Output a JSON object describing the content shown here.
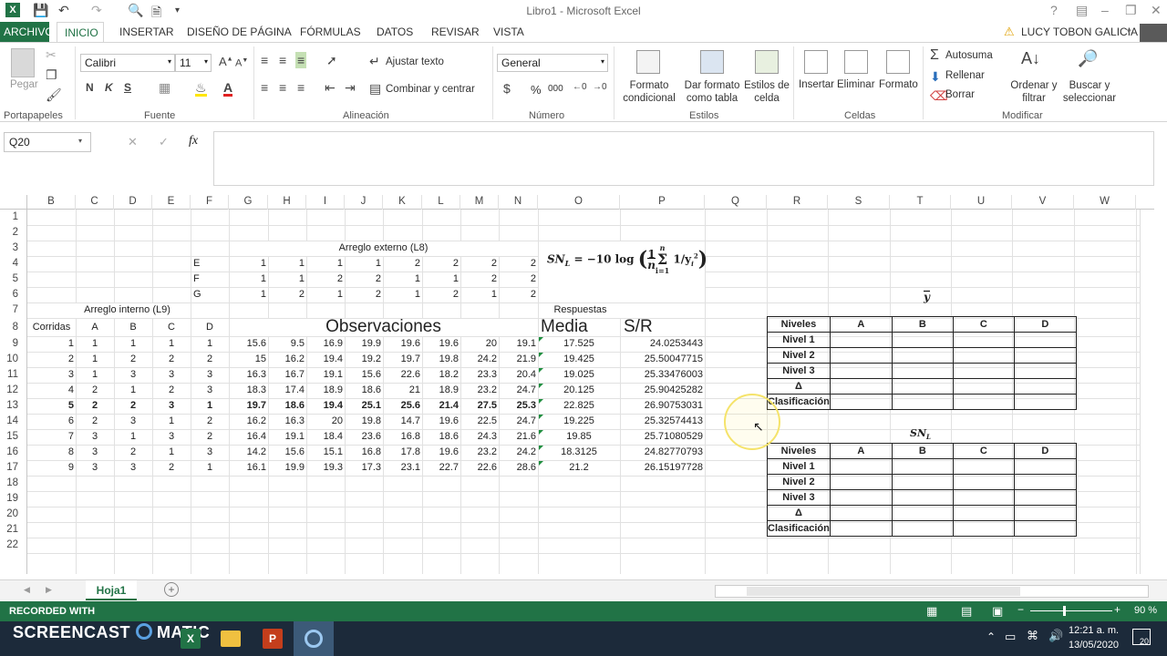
{
  "window": {
    "title": "Libro1 - Microsoft Excel",
    "user": "LUCY TOBON GALICIA"
  },
  "tabs": [
    "ARCHIVO",
    "INICIO",
    "INSERTAR",
    "DISEÑO DE PÁGINA",
    "FÓRMULAS",
    "DATOS",
    "REVISAR",
    "VISTA"
  ],
  "ribbon": {
    "clipboard": {
      "paste": "Pegar",
      "label": "Portapapeles"
    },
    "font": {
      "name": "Calibri",
      "size": "11",
      "bold": "N",
      "italic": "K",
      "underline": "S",
      "label": "Fuente"
    },
    "alignment": {
      "wrap": "Ajustar texto",
      "merge": "Combinar y centrar",
      "label": "Alineación"
    },
    "number": {
      "format": "General",
      "percent": "%",
      "thousands": "000",
      "label": "Número"
    },
    "styles": {
      "conditional": "Formato condicional",
      "as_table": "Dar formato como tabla",
      "cell_styles": "Estilos de celda",
      "label": "Estilos"
    },
    "cells": {
      "insert": "Insertar",
      "delete": "Eliminar",
      "format": "Formato",
      "label": "Celdas"
    },
    "editing": {
      "autosum": "Autosuma",
      "fill": "Rellenar",
      "clear": "Borrar",
      "sort": "Ordenar y filtrar",
      "find": "Buscar y seleccionar",
      "label": "Modificar"
    }
  },
  "formula_bar": {
    "namebox": "Q20",
    "fx": "fx",
    "value": ""
  },
  "columns": [
    "B",
    "C",
    "D",
    "E",
    "F",
    "G",
    "H",
    "I",
    "J",
    "K",
    "L",
    "M",
    "N",
    "O",
    "P",
    "Q",
    "R",
    "S",
    "T",
    "U",
    "V",
    "W"
  ],
  "rows": [
    "1",
    "2",
    "3",
    "4",
    "5",
    "6",
    "7",
    "8",
    "9",
    "10",
    "11",
    "12",
    "13",
    "14",
    "15",
    "16",
    "17",
    "18",
    "19",
    "20",
    "21",
    "22"
  ],
  "sheet": {
    "outer_array_title": "Arreglo externo (L8)",
    "outer_array": [
      {
        "factor": "E",
        "values": [
          "1",
          "1",
          "1",
          "1",
          "2",
          "2",
          "2",
          "2"
        ]
      },
      {
        "factor": "F",
        "values": [
          "1",
          "1",
          "2",
          "2",
          "1",
          "1",
          "2",
          "2"
        ]
      },
      {
        "factor": "G",
        "values": [
          "1",
          "2",
          "1",
          "2",
          "1",
          "2",
          "1",
          "2"
        ]
      }
    ],
    "formula": {
      "lhs": "SN",
      "sub": "L",
      "eq": "= −10 log",
      "frac_top": "1",
      "frac_bot": "n",
      "sum_top": "n",
      "sum_bot": "i=1",
      "term": "1/y",
      "term_sub": "i",
      "term_sup": "2"
    },
    "inner_array_title": "Arreglo interno (L9)",
    "responses_title": "Respuestas",
    "headers": {
      "runs": "Corridas",
      "A": "A",
      "B": "B",
      "C": "C",
      "D": "D",
      "observations": "Observaciones",
      "mean": "Media",
      "sr": "S/R"
    },
    "runs": [
      {
        "n": "1",
        "f": [
          "1",
          "1",
          "1",
          "1"
        ],
        "obs": [
          "15.6",
          "9.5",
          "16.9",
          "19.9",
          "19.6",
          "19.6",
          "20",
          "19.1"
        ],
        "mean": "17.525",
        "sr": "24.0253443",
        "bold": false
      },
      {
        "n": "2",
        "f": [
          "1",
          "2",
          "2",
          "2"
        ],
        "obs": [
          "15",
          "16.2",
          "19.4",
          "19.2",
          "19.7",
          "19.8",
          "24.2",
          "21.9"
        ],
        "mean": "19.425",
        "sr": "25.50047715",
        "bold": false
      },
      {
        "n": "3",
        "f": [
          "1",
          "3",
          "3",
          "3"
        ],
        "obs": [
          "16.3",
          "16.7",
          "19.1",
          "15.6",
          "22.6",
          "18.2",
          "23.3",
          "20.4"
        ],
        "mean": "19.025",
        "sr": "25.33476003",
        "bold": false
      },
      {
        "n": "4",
        "f": [
          "2",
          "1",
          "2",
          "3"
        ],
        "obs": [
          "18.3",
          "17.4",
          "18.9",
          "18.6",
          "21",
          "18.9",
          "23.2",
          "24.7"
        ],
        "mean": "20.125",
        "sr": "25.90425282",
        "bold": false
      },
      {
        "n": "5",
        "f": [
          "2",
          "2",
          "3",
          "1"
        ],
        "obs": [
          "19.7",
          "18.6",
          "19.4",
          "25.1",
          "25.6",
          "21.4",
          "27.5",
          "25.3"
        ],
        "mean": "22.825",
        "sr": "26.90753031",
        "bold": true
      },
      {
        "n": "6",
        "f": [
          "2",
          "3",
          "1",
          "2"
        ],
        "obs": [
          "16.2",
          "16.3",
          "20",
          "19.8",
          "14.7",
          "19.6",
          "22.5",
          "24.7"
        ],
        "mean": "19.225",
        "sr": "25.32574413",
        "bold": false
      },
      {
        "n": "7",
        "f": [
          "3",
          "1",
          "3",
          "2"
        ],
        "obs": [
          "16.4",
          "19.1",
          "18.4",
          "23.6",
          "16.8",
          "18.6",
          "24.3",
          "21.6"
        ],
        "mean": "19.85",
        "sr": "25.71080529",
        "bold": false
      },
      {
        "n": "8",
        "f": [
          "3",
          "2",
          "1",
          "3"
        ],
        "obs": [
          "14.2",
          "15.6",
          "15.1",
          "16.8",
          "17.8",
          "19.6",
          "23.2",
          "24.2"
        ],
        "mean": "18.3125",
        "sr": "24.82770793",
        "bold": false
      },
      {
        "n": "9",
        "f": [
          "3",
          "3",
          "2",
          "1"
        ],
        "obs": [
          "16.1",
          "19.9",
          "19.3",
          "17.3",
          "23.1",
          "22.7",
          "22.6",
          "28.6"
        ],
        "mean": "21.2",
        "sr": "26.15197728",
        "bold": false
      }
    ],
    "ybar_label": "y",
    "sn_label": "SN",
    "sn_sub": "L",
    "summary_headers": [
      "Niveles",
      "A",
      "B",
      "C",
      "D"
    ],
    "summary_rows": [
      "Nivel 1",
      "Nivel 2",
      "Nivel 3",
      "Δ",
      "Clasificación"
    ]
  },
  "sheet_tab": "Hoja1",
  "status": {
    "recorded": "RECORDED WITH",
    "zoom": "90 %",
    "brand": "SCREENCAST",
    "brand2": "MATIC"
  },
  "taskbar": {
    "time": "12:21 a. m.",
    "date": "13/05/2020",
    "notifications": "20"
  }
}
